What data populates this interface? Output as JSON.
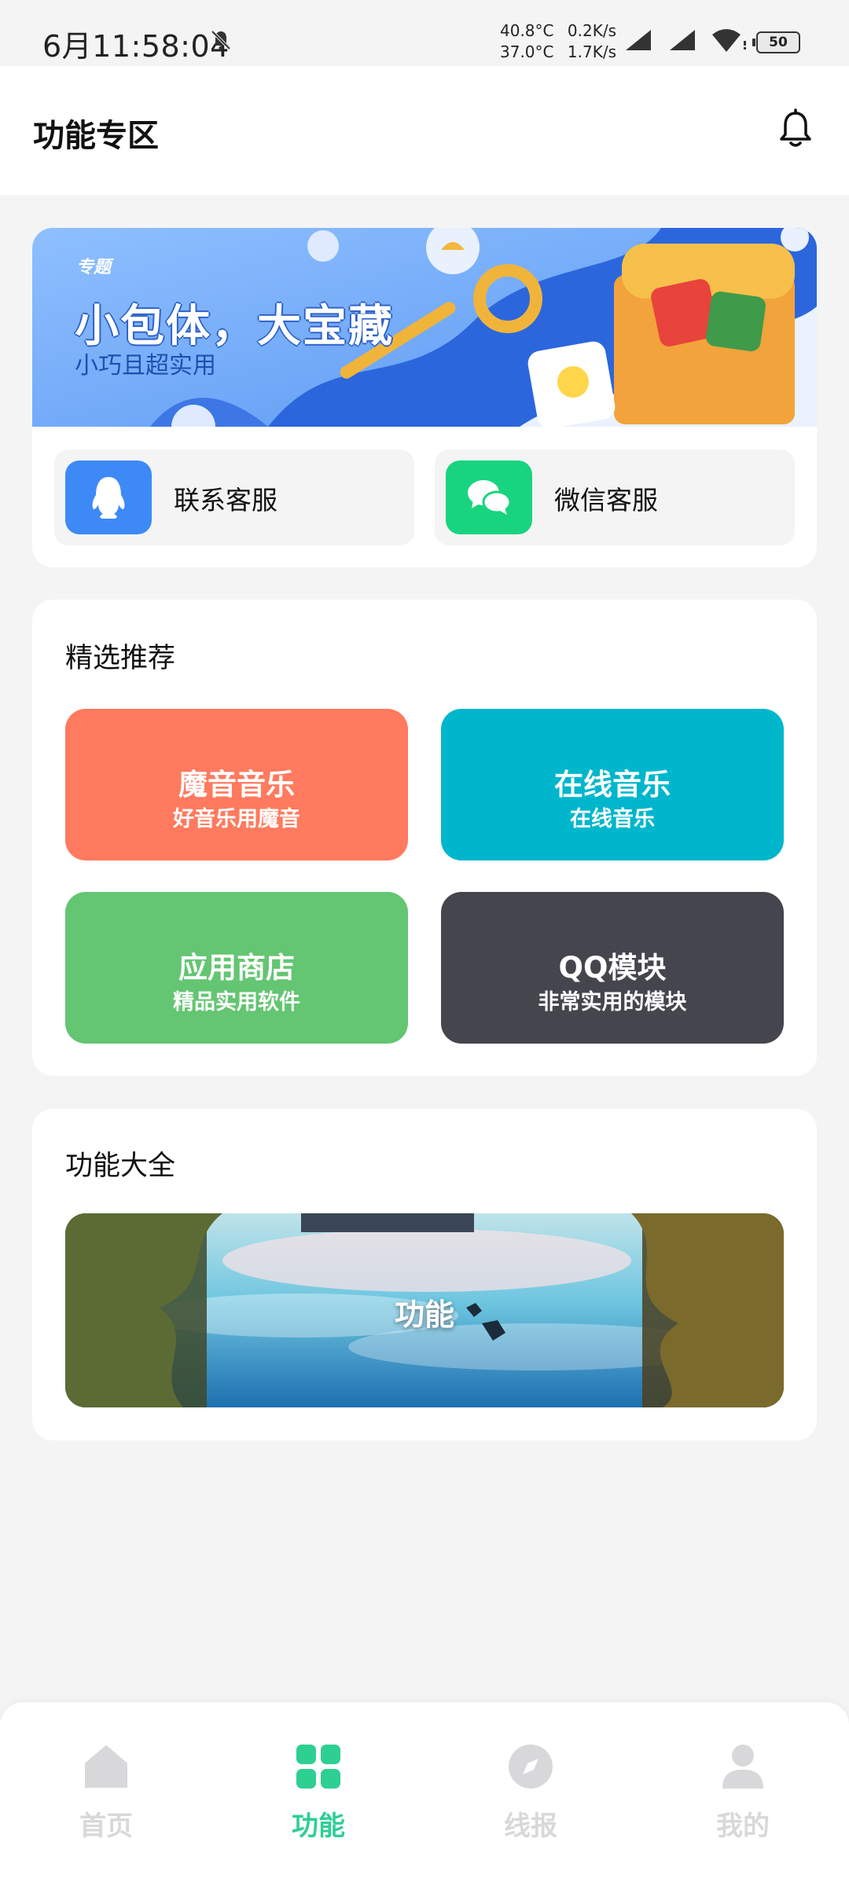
{
  "status_bar": {
    "time": "6月11:58:04",
    "temp1": "40.8°C",
    "speed1": "0.2K/s",
    "temp2": "37.0°C",
    "speed2": "1.7K/s",
    "battery": "50",
    "icons": [
      "mute-bell-icon",
      "signal-icon",
      "signal-icon",
      "wifi-icon",
      "battery-icon"
    ]
  },
  "header": {
    "title": "功能专区",
    "bell_icon": "bell-icon"
  },
  "banner": {
    "tag": "专题",
    "title": "小包体，大宝藏",
    "subtitle": "小巧且超实用"
  },
  "services": [
    {
      "label": "联系客服",
      "icon": "qq-penguin-icon",
      "color": "#3d8af7"
    },
    {
      "label": "微信客服",
      "icon": "wechat-icon",
      "color": "#19d47e"
    }
  ],
  "featured": {
    "title": "精选推荐",
    "tiles": [
      {
        "title": "魔音音乐",
        "subtitle": "好音乐用魔音",
        "color": "#ff7a5e"
      },
      {
        "title": "在线音乐",
        "subtitle": "在线音乐",
        "color": "#00b6cc"
      },
      {
        "title": "应用商店",
        "subtitle": "精品实用软件",
        "color": "#64c572"
      },
      {
        "title": "QQ模块",
        "subtitle": "非常实用的模块",
        "color": "#45454e"
      }
    ]
  },
  "functions": {
    "title": "功能大全",
    "image_label": "功能"
  },
  "nav": {
    "items": [
      {
        "label": "首页",
        "icon": "home-icon"
      },
      {
        "label": "功能",
        "icon": "grid-icon"
      },
      {
        "label": "线报",
        "icon": "compass-icon"
      },
      {
        "label": "我的",
        "icon": "user-icon"
      }
    ],
    "active_color": "#2ecf93",
    "inactive_color": "#d8d8da"
  }
}
